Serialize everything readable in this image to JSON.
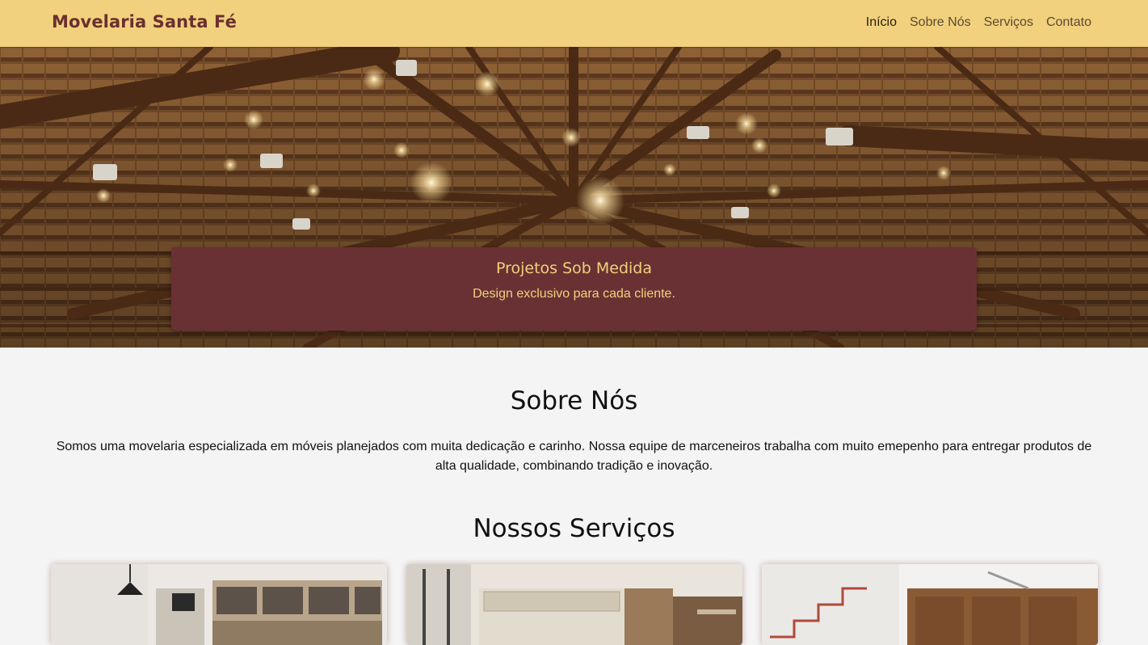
{
  "navbar": {
    "brand": "Movelaria Santa Fé",
    "links": [
      {
        "label": "Início",
        "active": true
      },
      {
        "label": "Sobre Nós",
        "active": false
      },
      {
        "label": "Serviços",
        "active": false
      },
      {
        "label": "Contato",
        "active": false
      }
    ]
  },
  "hero": {
    "card_title": "Projetos Sob Medida",
    "card_subtitle": "Design exclusivo para cada cliente."
  },
  "about": {
    "title": "Sobre Nós",
    "text": "Somos uma movelaria especializada em móveis planejados com muita dedicação e carinho. Nossa equipe de marceneiros trabalha com muito emepenho para entregar produtos de alta qualidade, combinando tradição e inovação."
  },
  "services": {
    "title": "Nossos Serviços"
  },
  "colors": {
    "navbar_bg": "#f1d17d",
    "brand": "#6b2f30",
    "hero_card_bg": "#6a3134",
    "hero_card_text": "#f1d17d",
    "page_bg": "#f4f4f4"
  }
}
